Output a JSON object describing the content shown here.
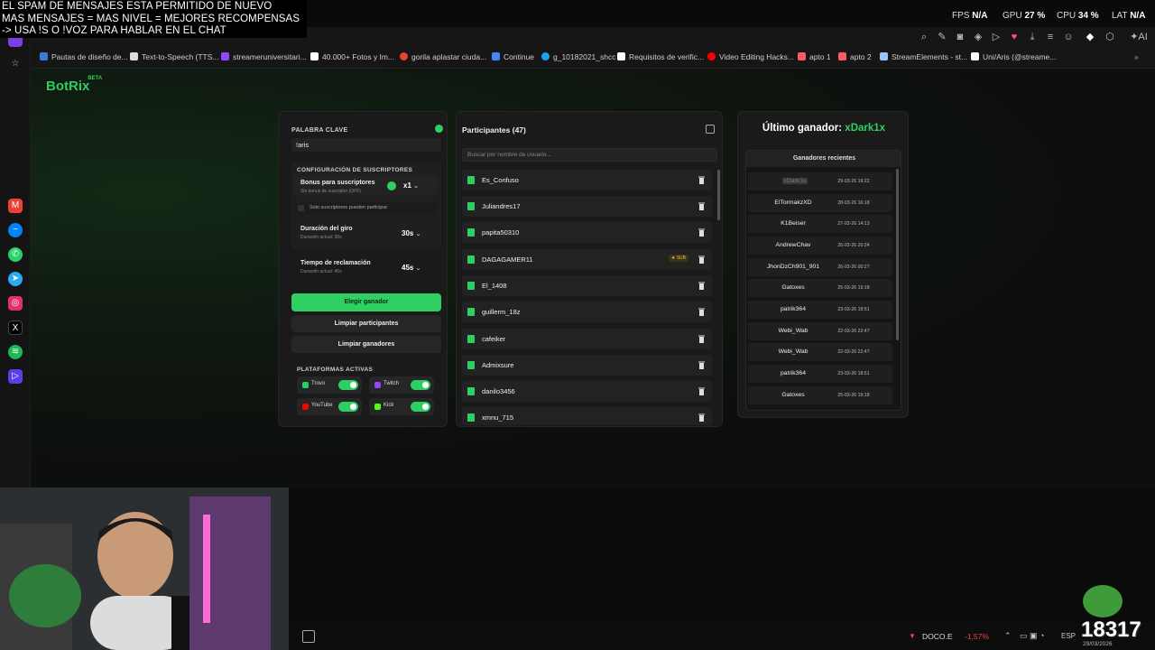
{
  "overlay": {
    "lines": [
      "EL SPAM DE MENSAJES ESTA PERMITIDO DE NUEVO",
      "MAS MENSAJES = MAS NIVEL = MEJORES RECOMPENSAS",
      "-> USA !S  O !VOZ PARA HABLAR EN EL CHAT"
    ]
  },
  "stats": {
    "fps_label": "FPS",
    "fps_value": "N/A",
    "gpu_label": "GPU",
    "gpu_value": "27 %",
    "cpu_label": "CPU",
    "cpu_value": "34 %",
    "lat_label": "LAT",
    "lat_value": "N/A"
  },
  "bookmarks": [
    {
      "label": "Pautas de diseño de...",
      "color": "#3a7bd5"
    },
    {
      "label": "Text-to-Speech (TTS...",
      "color": "#dddddd"
    },
    {
      "label": "streameruniversitari...",
      "color": "#9146ff"
    },
    {
      "label": "40.000+ Fotos y Im...",
      "color": "#ffffff"
    },
    {
      "label": "gorila aplastar ciuda...",
      "color": "#ea4335"
    },
    {
      "label": "Continue",
      "color": "#4285f4"
    },
    {
      "label": "g_10182021_shcc",
      "color": "#1da1f2"
    },
    {
      "label": "Requisitos de verific...",
      "color": "#ffffff"
    },
    {
      "label": "Video Editing Hacks...",
      "color": "#ff0000"
    },
    {
      "label": "apto 1",
      "color": "#ff5a5f"
    },
    {
      "label": "apto 2",
      "color": "#ff5a5f"
    },
    {
      "label": "StreamElements - st...",
      "color": "#9cc3ff"
    },
    {
      "label": "Uni/Aris (@streame...",
      "color": "#ffffff"
    }
  ],
  "app": {
    "logo": "BotRix",
    "logo_badge": "BETA"
  },
  "settings": {
    "keyword_label": "PALABRA CLAVE",
    "keyword_value": "!aris",
    "subs_config_label": "CONFIGURACIÓN DE SUSCRIPTORES",
    "bonus_title": "Bonus para suscriptores",
    "bonus_hint": "Sin bonus de suscriptor (OFF)",
    "bonus_value": "x1",
    "subs_only_label": "Solo suscriptores pueden participar",
    "spin_title": "Duración del giro",
    "spin_hint": "Duración actual: 30s",
    "spin_value": "30s",
    "claim_title": "Tiempo de reclamación",
    "claim_hint": "Duración actual: 45s",
    "claim_value": "45s",
    "pick_winner": "Elegir ganador",
    "clear_participants": "Limpiar participantes",
    "clear_winners": "Limpiar ganadores",
    "platforms_label": "PLATAFORMAS ACTIVAS",
    "platforms": [
      {
        "name": "Trovo",
        "color": "#19d66b",
        "active": true
      },
      {
        "name": "Twitch",
        "color": "#9146ff",
        "active": true
      },
      {
        "name": "YouTube",
        "color": "#ff0000",
        "active": true
      },
      {
        "name": "Kick",
        "color": "#53fc18",
        "active": true
      }
    ]
  },
  "participants": {
    "title": "Participantes (47)",
    "search_placeholder": "Buscar por nombre de usuario...",
    "sub_badge": "SUB",
    "list": [
      {
        "name": "Es_Confuso",
        "sub": false
      },
      {
        "name": "Juliandres17",
        "sub": false
      },
      {
        "name": "papita50310",
        "sub": false
      },
      {
        "name": "DAGAGAMER11",
        "sub": true
      },
      {
        "name": "El_1408",
        "sub": false
      },
      {
        "name": "guillerm_18z",
        "sub": false
      },
      {
        "name": "cafeiker",
        "sub": false
      },
      {
        "name": "Admixsure",
        "sub": false
      },
      {
        "name": "danilo3456",
        "sub": false
      },
      {
        "name": "xmnu_715",
        "sub": false
      }
    ]
  },
  "winner": {
    "label": "Último ganador:",
    "name": "xDark1x",
    "recent_title": "Ganadores recientes",
    "recent": [
      {
        "name": "xDark1x",
        "date": "29-03-26 19:22"
      },
      {
        "name": "ElTormakzXD",
        "date": "28-03-26 16:18"
      },
      {
        "name": "K1Beiser",
        "date": "27-03-26 14:13"
      },
      {
        "name": "AndrewChav",
        "date": "26-03-26 20:24"
      },
      {
        "name": "JhonDzCh901_901",
        "date": "26-03-26 00:27"
      },
      {
        "name": "Gatoxes",
        "date": "25-03-26 19:18"
      },
      {
        "name": "patrik364",
        "date": "23-03-26 18:51"
      },
      {
        "name": "Webi_Wab",
        "date": "22-03-26 22:47"
      },
      {
        "name": "Webi_Wab",
        "date": "22-03-26 22:47"
      },
      {
        "name": "patrik364",
        "date": "23-03-26 18:51"
      },
      {
        "name": "Gatoxes",
        "date": "25-03-26 19:18"
      }
    ]
  },
  "taskbar": {
    "ticker": "DOCO.E",
    "ticker_change": "-1,57%",
    "lang": "ESP",
    "date": "29/03/2026",
    "counter": "18317"
  }
}
